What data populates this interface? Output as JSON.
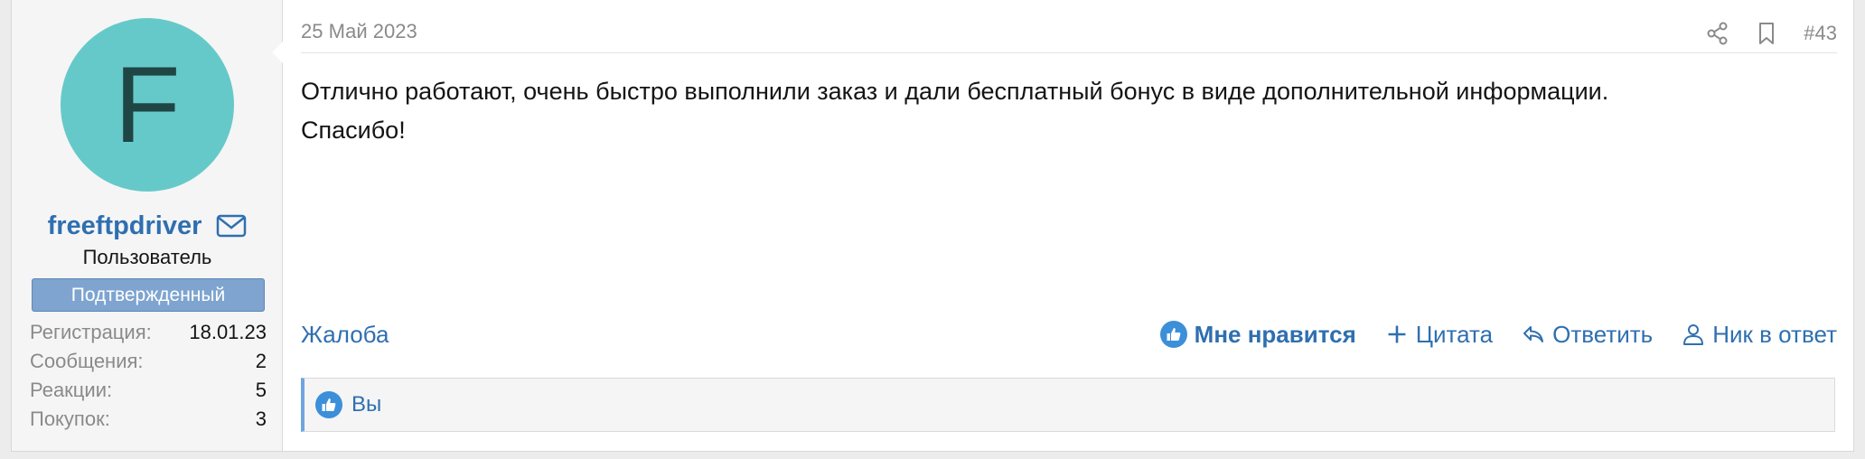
{
  "user": {
    "avatar_letter": "F",
    "avatar_color": "#66c9c9",
    "username": "freeftpdriver",
    "title": "Пользователь",
    "banner": "Подтвержденный",
    "stats": [
      {
        "label": "Регистрация:",
        "value": "18.01.23"
      },
      {
        "label": "Сообщения:",
        "value": "2"
      },
      {
        "label": "Реакции:",
        "value": "5"
      },
      {
        "label": "Покупок:",
        "value": "3"
      }
    ]
  },
  "post": {
    "date": "25 Май 2023",
    "number": "#43",
    "header_icons": [
      "share-icon",
      "bookmark-icon"
    ],
    "message_line1": "Отлично работают, очень быстро выполнили заказ и дали бесплатный бонус в виде дополнительной информации.",
    "message_line2": "Спасибо!"
  },
  "actions": {
    "report": "Жалоба",
    "like": "Мне нравится",
    "quote": "Цитата",
    "reply": "Ответить",
    "mention": "Ник в ответ"
  },
  "reactions": {
    "who": "Вы"
  },
  "colors": {
    "link": "#2f6fb0",
    "banner_bg": "#7ea4cf",
    "like_icon": "#3c8fd9",
    "reaction_bar_accent": "#6fa5dc"
  }
}
